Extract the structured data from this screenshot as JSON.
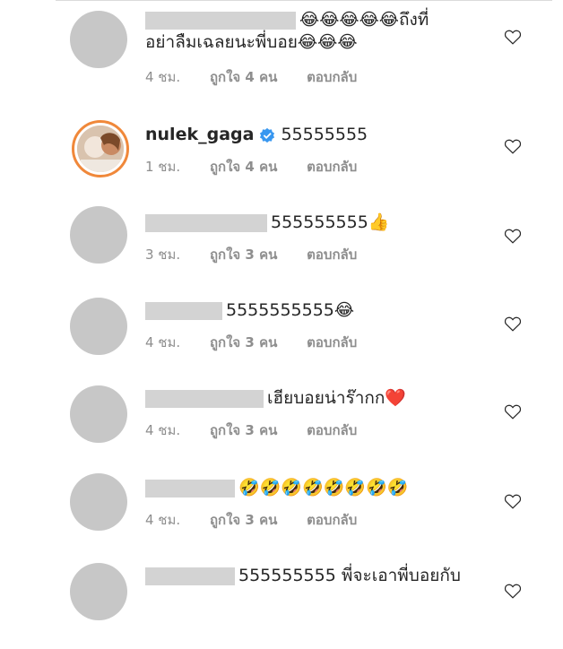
{
  "comments": [
    {
      "text": "😂😂😂😂😂ถึงที่",
      "text2": "อย่าลืมเฉลยนะพี่บอย😂😂😂",
      "time": "4 ชม.",
      "likes": "ถูกใจ 4 คน",
      "reply": "ตอบกลับ"
    },
    {
      "username": "nulek_gaga",
      "text": "55555555",
      "time": "1 ชม.",
      "likes": "ถูกใจ 4 คน",
      "reply": "ตอบกลับ"
    },
    {
      "text": "555555555👍",
      "time": "3 ชม.",
      "likes": "ถูกใจ 3 คน",
      "reply": "ตอบกลับ"
    },
    {
      "text": "5555555555😂",
      "time": "4 ชม.",
      "likes": "ถูกใจ 3 คน",
      "reply": "ตอบกลับ"
    },
    {
      "text": "เฮียบอยน่าร๊ากก❤️",
      "time": "4 ชม.",
      "likes": "ถูกใจ 3 คน",
      "reply": "ตอบกลับ"
    },
    {
      "text": "🤣🤣🤣🤣🤣🤣🤣🤣",
      "time": "4 ชม.",
      "likes": "ถูกใจ 3 คน",
      "reply": "ตอบกลับ"
    },
    {
      "text": "555555555 พี่จะเอาพี่บอยกับ"
    }
  ],
  "icons": {
    "like": "heart-outline-icon",
    "verified": "verified-badge-icon"
  },
  "colors": {
    "meta": "#8e8e8e",
    "verified": "#3897f0",
    "placeholder": "#c7c7c7"
  }
}
